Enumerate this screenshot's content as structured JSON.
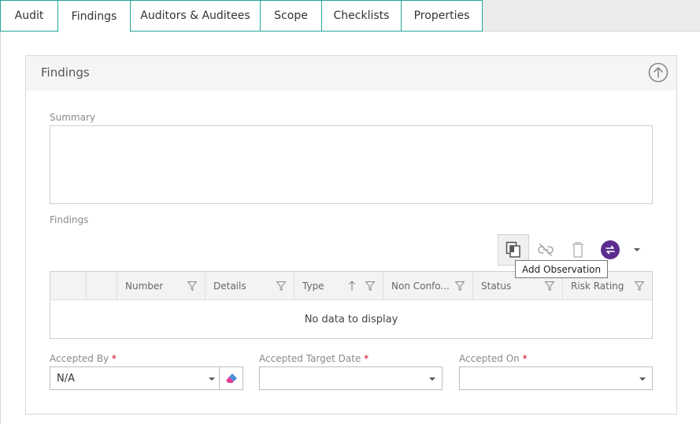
{
  "tabs": [
    {
      "label": "Audit"
    },
    {
      "label": "Findings"
    },
    {
      "label": "Auditors & Auditees"
    },
    {
      "label": "Scope"
    },
    {
      "label": "Checklists"
    },
    {
      "label": "Properties"
    }
  ],
  "panel": {
    "title": "Findings",
    "summary_label": "Summary",
    "summary_value": "",
    "findings_label": "Findings"
  },
  "toolbar": {
    "tooltip": "Add Observation",
    "icons": [
      "add-observation-icon",
      "unlink-icon",
      "delete-icon",
      "sync-icon",
      "dropdown-caret-icon"
    ],
    "accent_color": "#5b2d8e"
  },
  "grid": {
    "columns": [
      {
        "label": "Number"
      },
      {
        "label": "Details"
      },
      {
        "label": "Type"
      },
      {
        "label": "Non Confo..."
      },
      {
        "label": "Status"
      },
      {
        "label": "Risk Rating"
      }
    ],
    "empty_text": "No data to display"
  },
  "form": {
    "accepted_by": {
      "label": "Accepted By",
      "required_mark": "*",
      "value": "N/A"
    },
    "accepted_target_date": {
      "label": "Accepted Target Date",
      "required_mark": "*",
      "value": ""
    },
    "accepted_on": {
      "label": "Accepted On",
      "required_mark": "*",
      "value": ""
    }
  },
  "colors": {
    "tab_border": "#26a69a",
    "required": "#d0021b"
  }
}
